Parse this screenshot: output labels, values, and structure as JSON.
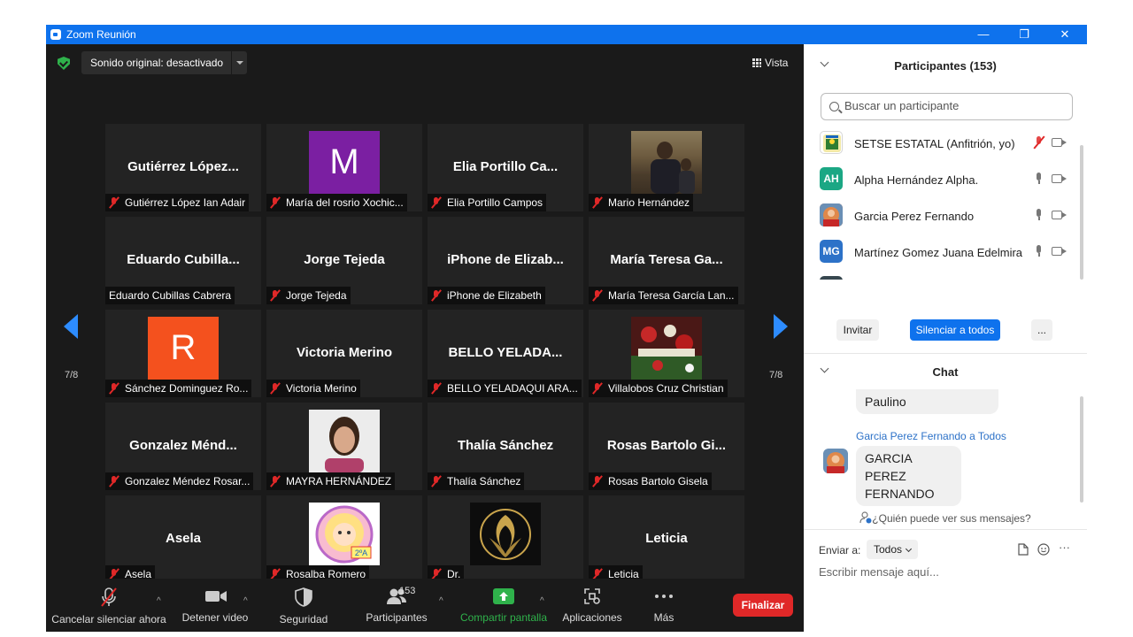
{
  "window": {
    "title": "Zoom Reunión",
    "minimize_glyph": "—",
    "restore_glyph": "❐",
    "close_glyph": "✕"
  },
  "stage": {
    "sound_button_label": "Sonido original: desactivado",
    "view_label": "Vista",
    "page_indicator": "7/8",
    "tiles": [
      {
        "bigname": "Gutiérrez  López...",
        "label": "Gutiérrez López Ian Adair",
        "muted": true
      },
      {
        "avatar_letter": "M",
        "avatar_color": "#7b1fa2",
        "label": "María del rosrio Xochic...",
        "muted": true
      },
      {
        "bigname": "Elia  Portillo  Ca...",
        "label": "Elia Portillo Campos",
        "muted": true
      },
      {
        "photo": "person-outdoor-photo",
        "label": "Mario Hernández",
        "muted": true
      },
      {
        "bigname": "Eduardo  Cubilla...",
        "label": "Eduardo Cubillas Cabrera",
        "muted": false
      },
      {
        "bigname": "Jorge Tejeda",
        "label": "Jorge Tejeda",
        "muted": true
      },
      {
        "bigname": "iPhone  de  Elizab...",
        "label": "iPhone de Elizabeth",
        "muted": true
      },
      {
        "bigname": "María Teresa Ga...",
        "label": "María Teresa García Lan...",
        "muted": true
      },
      {
        "avatar_letter": "R",
        "avatar_color": "#f4511e",
        "label": "Sánchez Dominguez Ro...",
        "muted": true
      },
      {
        "bigname": "Victoria Merino",
        "label": "Victoria Merino",
        "muted": true
      },
      {
        "bigname": "BELLO YELADA...",
        "label": "BELLO YELADAQUI ARA...",
        "muted": true
      },
      {
        "photo": "christmas-decoration-photo",
        "label": "Villalobos Cruz Christian",
        "muted": true
      },
      {
        "bigname": "Gonzalez  Ménd...",
        "label": "Gonzalez Méndez Rosar...",
        "muted": true
      },
      {
        "photo": "woman-selfie-photo",
        "label": "MAYRA HERNÁNDEZ",
        "muted": true
      },
      {
        "bigname": "Thalía Sánchez",
        "label": "Thalía Sánchez",
        "muted": true
      },
      {
        "bigname": "Rosas Bartolo Gi...",
        "label": "Rosas Bartolo Gisela",
        "muted": true
      },
      {
        "bigname": "Asela",
        "label": "Asela",
        "muted": true
      },
      {
        "photo": "cartoon-girl-badge",
        "label": "Rosalba Romero",
        "muted": true
      },
      {
        "photo": "golden-phoenix-logo",
        "label": "Dr.",
        "muted": true
      },
      {
        "bigname": "Leticia",
        "label": "Leticia",
        "muted": true
      }
    ]
  },
  "toolbar": {
    "unmute_label": "Cancelar silenciar ahora",
    "stop_video_label": "Detener video",
    "security_label": "Seguridad",
    "participants_label": "Participantes",
    "participants_count": "153",
    "share_label": "Compartir pantalla",
    "apps_label": "Aplicaciones",
    "more_label": "Más",
    "end_label": "Finalizar",
    "caret_glyph": "^",
    "share_color": "#2fb24b",
    "end_color": "#e02828"
  },
  "participants_panel": {
    "title": "Participantes (153)",
    "search_placeholder": "Buscar un participante",
    "rows": [
      {
        "name": "SETSE ESTATAL (Anfitrión, yo)",
        "avatar": "setse-logo-icon",
        "mic_muted": true
      },
      {
        "name": "Alpha Hernández Alpha.",
        "initials": "AH",
        "color": "#1ba784",
        "mic_muted": false
      },
      {
        "name": "Garcia Perez Fernando",
        "avatar": "photo",
        "mic_muted": false
      },
      {
        "name": "Martínez Gomez  Juana Edelmira",
        "initials": "MG",
        "color": "#2d72c8",
        "mic_muted": false
      }
    ],
    "invite_label": "Invitar",
    "mute_all_label": "Silenciar a todos",
    "more_label": "..."
  },
  "chat": {
    "title": "Chat",
    "prev_message": "Paulino",
    "sender_line": "Garcia Perez Fernando a Todos",
    "message": "GARCIA PEREZ FERNANDO",
    "message_line1": "GARCIA PEREZ",
    "message_line2": "FERNANDO",
    "who_can_see": "¿Quién puede ver sus mensajes?",
    "send_to_label": "Enviar a:",
    "send_to_value": "Todos",
    "input_placeholder": "Escribir mensaje aquí...",
    "more_glyph": "···"
  }
}
